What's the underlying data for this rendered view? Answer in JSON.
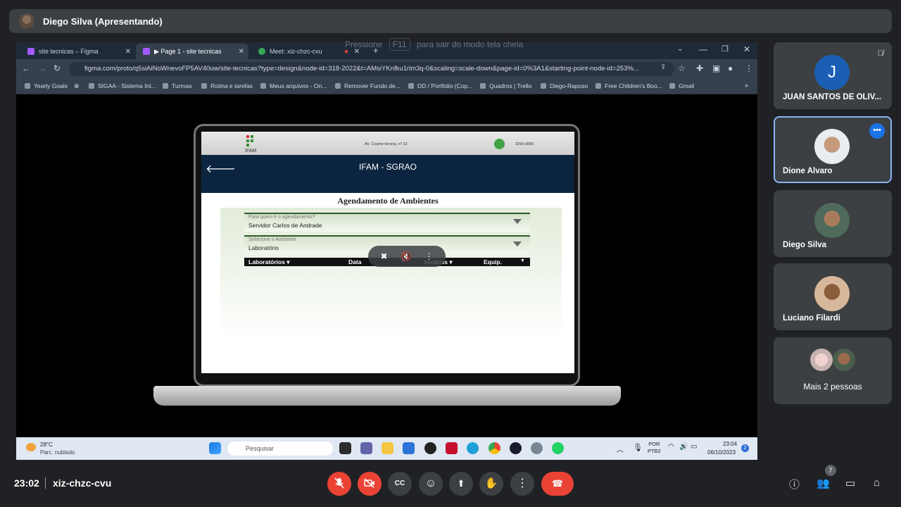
{
  "presenter": {
    "name": "Diego Silva (Apresentando)"
  },
  "fullscreen_hint": {
    "prefix": "Pressione",
    "key": "F11",
    "suffix": "para sair do modo tela cheia"
  },
  "browser": {
    "tabs": [
      {
        "label": "site tecnicas – Figma"
      },
      {
        "label": "▶ Page 1 - site tecnicas"
      },
      {
        "label": "Meet: xiz-chzc-cvu"
      }
    ],
    "url": "figma.com/proto/q5siAiNoWnevoFP5AV40uw/site-tecnicas?type=design&node-id=318-2022&t=AMsiYKnfku1rlm3q-0&scaling=scale-down&page-id=0%3A1&starting-point-node-id=253%...",
    "bookmarks": [
      "Yearly Goals",
      "SIGAA - Sistema Int...",
      "Turmas",
      "Rotina e tarefas",
      "Meus arquivos - On...",
      "Remover Fundo de...",
      "DD / Portfolio (Cop...",
      "Quadros | Trello",
      "Diego-Raposo",
      "Free Children's Boo...",
      "Gmail"
    ]
  },
  "app": {
    "logo_text": "IFAM",
    "address": "AV. Cosme ferrera, nº 13",
    "phone": "3290-0056",
    "title": "IFAM - SGRAO",
    "section_title": "Agendamento de Ambientes",
    "field1": {
      "label": "Para quem é o agendamento?",
      "value": "Servidor Carlos de Andrade"
    },
    "field2": {
      "label": "Selecione o  Ambiente",
      "value": "Laboratório"
    },
    "filters": [
      "Laboratórios ▾",
      "Data",
      "horários ▾",
      "Equip."
    ]
  },
  "taskbar": {
    "temperature": "28°C",
    "weather": "Parc. nublado",
    "search_placeholder": "Pesquisar",
    "lang_line1": "POR",
    "lang_line2": "PTB2",
    "time": "23:04",
    "date": "06/10/2023",
    "notifications": "2"
  },
  "participants": [
    {
      "name": "JUAN SANTOS DE OLIV...",
      "initial": "J"
    },
    {
      "name": "Dione Alvaro"
    },
    {
      "name": "Diego Silva"
    },
    {
      "name": "Luciano Filardi"
    },
    {
      "name": "Mais 2 pessoas"
    }
  ],
  "meeting": {
    "time": "23:02",
    "code": "xiz-chzc-cvu",
    "people_count": "7"
  },
  "colors": {
    "accent": "#8ab4f8",
    "danger": "#ea4335",
    "surface": "#3c4043",
    "background": "#202124"
  }
}
